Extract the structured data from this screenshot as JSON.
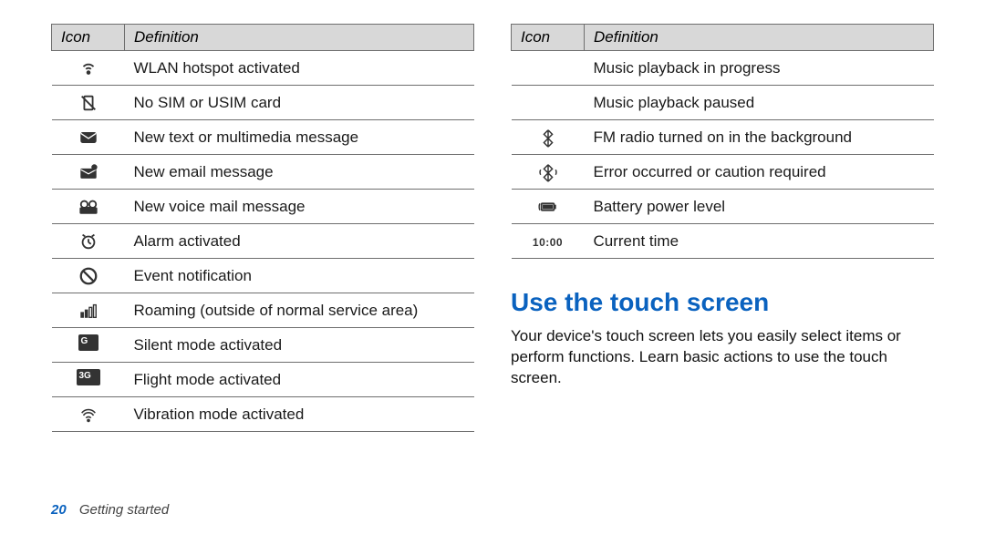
{
  "left_table": {
    "header_icon": "Icon",
    "header_def": "Definition",
    "rows": [
      {
        "icon": "wlan-hotspot-icon",
        "def": "WLAN hotspot activated"
      },
      {
        "icon": "no-sim-icon",
        "def": "No SIM or USIM card"
      },
      {
        "icon": "new-message-icon",
        "def": "New text or multimedia message"
      },
      {
        "icon": "new-email-icon",
        "def": "New email message"
      },
      {
        "icon": "voicemail-icon",
        "def": "New voice mail message"
      },
      {
        "icon": "alarm-icon",
        "def": "Alarm activated"
      },
      {
        "icon": "event-notification-icon",
        "def": "Event notification"
      },
      {
        "icon": "roaming-icon",
        "def": "Roaming (outside of normal service area)"
      },
      {
        "icon": "silent-mode-icon",
        "def": "Silent mode activated"
      },
      {
        "icon": "flight-mode-icon",
        "def": "Flight mode activated"
      },
      {
        "icon": "vibration-mode-icon",
        "def": "Vibration mode activated"
      }
    ]
  },
  "right_table": {
    "header_icon": "Icon",
    "header_def": "Definition",
    "rows": [
      {
        "icon": "music-play-icon",
        "def": "Music playback in progress"
      },
      {
        "icon": "music-pause-icon",
        "def": "Music playback paused"
      },
      {
        "icon": "fm-radio-icon",
        "def": "FM radio turned on in the background"
      },
      {
        "icon": "error-caution-icon",
        "def": "Error occurred or caution required"
      },
      {
        "icon": "battery-level-icon",
        "def": "Battery power level"
      },
      {
        "icon": "clock-time-text",
        "icon_text": "10:00",
        "def": "Current time"
      }
    ]
  },
  "section": {
    "heading": "Use the touch screen",
    "body": "Your device's touch screen lets you easily select items or perform functions. Learn basic actions to use the touch screen."
  },
  "footer": {
    "page": "20",
    "section": "Getting started"
  }
}
